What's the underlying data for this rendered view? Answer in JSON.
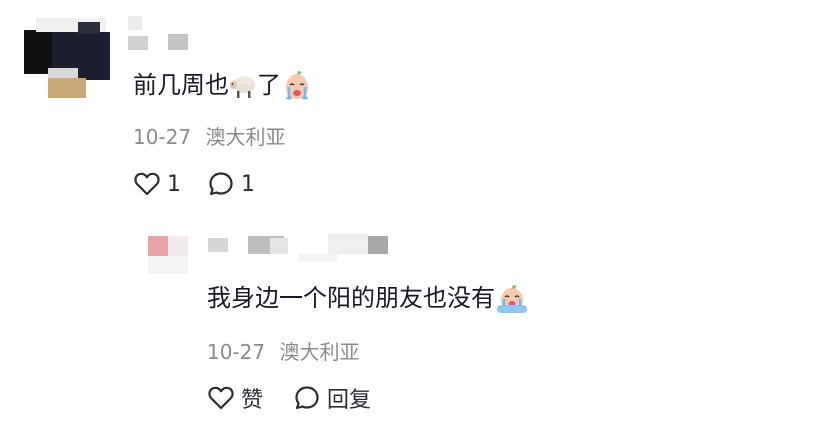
{
  "comment": {
    "text_before_emoji": "前几周也",
    "text_after_emoji": "了",
    "date": "10-27",
    "location": "澳大利亚",
    "like_count": "1",
    "reply_count": "1",
    "emojis": [
      "sheep-icon",
      "crying-face-icon"
    ]
  },
  "reply": {
    "text": "我身边一个阳的朋友也没有",
    "date": "10-27",
    "location": "澳大利亚",
    "like_label": "赞",
    "reply_label": "回复",
    "emojis": [
      "crying-face-icon"
    ]
  },
  "colors": {
    "text": "#161823",
    "meta": "#8a8b91",
    "icon": "#2a2b33"
  }
}
